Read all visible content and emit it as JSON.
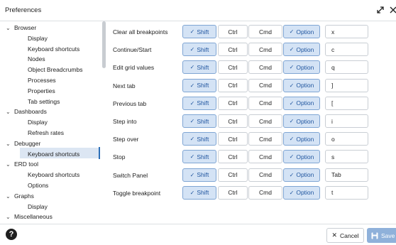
{
  "window": {
    "title": "Preferences"
  },
  "sidebar": {
    "items": [
      {
        "label": "Browser",
        "level": 0,
        "expanded": true
      },
      {
        "label": "Display",
        "level": 1
      },
      {
        "label": "Keyboard shortcuts",
        "level": 1
      },
      {
        "label": "Nodes",
        "level": 1
      },
      {
        "label": "Object Breadcrumbs",
        "level": 1
      },
      {
        "label": "Processes",
        "level": 1
      },
      {
        "label": "Properties",
        "level": 1
      },
      {
        "label": "Tab settings",
        "level": 1
      },
      {
        "label": "Dashboards",
        "level": 0,
        "expanded": true
      },
      {
        "label": "Display",
        "level": 1
      },
      {
        "label": "Refresh rates",
        "level": 1
      },
      {
        "label": "Debugger",
        "level": 0,
        "expanded": true
      },
      {
        "label": "Keyboard shortcuts",
        "level": 1,
        "selected": true
      },
      {
        "label": "ERD tool",
        "level": 0,
        "expanded": true
      },
      {
        "label": "Keyboard shortcuts",
        "level": 1
      },
      {
        "label": "Options",
        "level": 1
      },
      {
        "label": "Graphs",
        "level": 0,
        "expanded": true
      },
      {
        "label": "Display",
        "level": 1
      },
      {
        "label": "Miscellaneous",
        "level": 0,
        "expanded": true
      }
    ]
  },
  "modifiers": {
    "shift": "Shift",
    "ctrl": "Ctrl",
    "cmd": "Cmd",
    "option": "Option"
  },
  "shortcuts": [
    {
      "label": "Clear all breakpoints",
      "shift": true,
      "ctrl": false,
      "cmd": false,
      "option": true,
      "key": "x"
    },
    {
      "label": "Continue/Start",
      "shift": true,
      "ctrl": false,
      "cmd": false,
      "option": true,
      "key": "c"
    },
    {
      "label": "Edit grid values",
      "shift": true,
      "ctrl": false,
      "cmd": false,
      "option": true,
      "key": "q"
    },
    {
      "label": "Next tab",
      "shift": true,
      "ctrl": false,
      "cmd": false,
      "option": true,
      "key": "]"
    },
    {
      "label": "Previous tab",
      "shift": true,
      "ctrl": false,
      "cmd": false,
      "option": true,
      "key": "["
    },
    {
      "label": "Step into",
      "shift": true,
      "ctrl": false,
      "cmd": false,
      "option": true,
      "key": "i"
    },
    {
      "label": "Step over",
      "shift": true,
      "ctrl": false,
      "cmd": false,
      "option": true,
      "key": "o"
    },
    {
      "label": "Stop",
      "shift": true,
      "ctrl": false,
      "cmd": false,
      "option": true,
      "key": "s"
    },
    {
      "label": "Switch Panel",
      "shift": true,
      "ctrl": false,
      "cmd": false,
      "option": true,
      "key": "Tab"
    },
    {
      "label": "Toggle breakpoint",
      "shift": true,
      "ctrl": false,
      "cmd": false,
      "option": true,
      "key": "t"
    }
  ],
  "footer": {
    "cancel_label": "Cancel",
    "save_label": "Save"
  },
  "icons": {
    "help": "help-icon",
    "expand": "expand-icon",
    "close": "close-icon",
    "check": "check-icon",
    "save": "save-icon"
  },
  "colors": {
    "accent": "#2c6fb7",
    "active_bg": "#d4e3f5",
    "save_bg": "#8fb1da"
  }
}
